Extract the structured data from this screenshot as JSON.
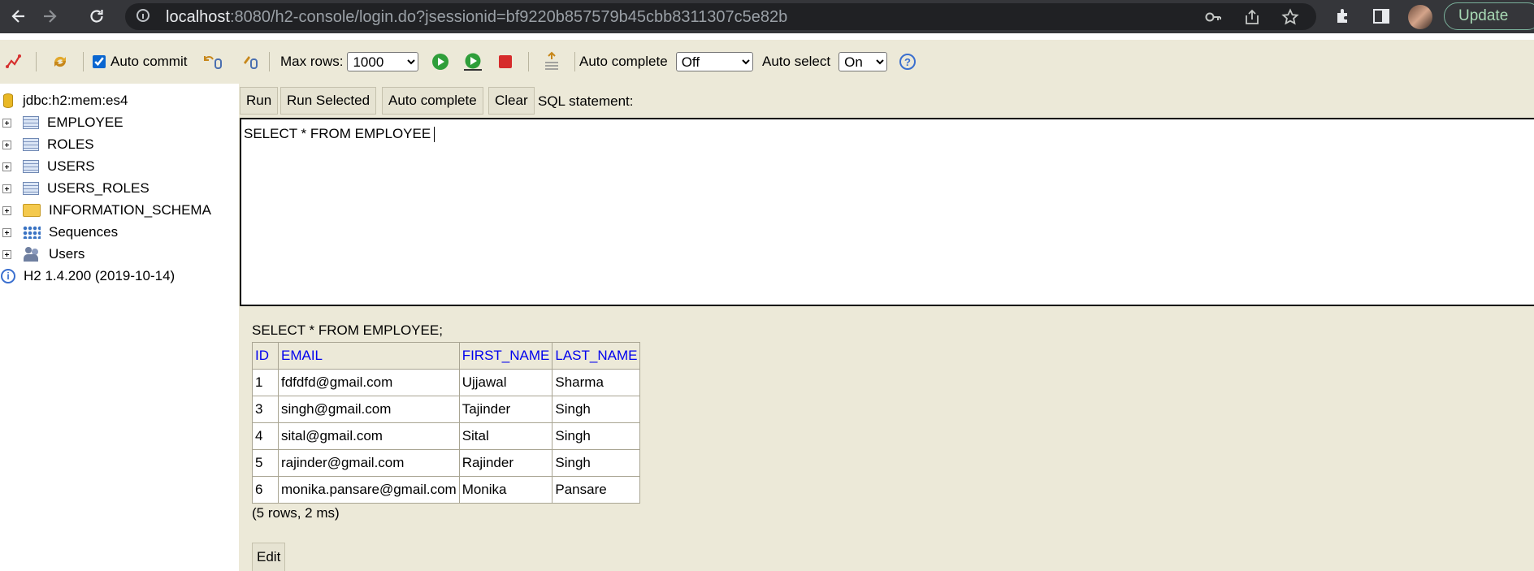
{
  "browser": {
    "url_host": "localhost",
    "url_rest": ":8080/h2-console/login.do?jsessionid=bf9220b857579b45cbb8311307c5e82b",
    "update_label": "Update"
  },
  "toolbar": {
    "auto_commit_label": "Auto commit",
    "auto_commit_checked": true,
    "max_rows_label": "Max rows:",
    "max_rows_value": "1000",
    "auto_complete_label": "Auto complete",
    "auto_complete_value": "Off",
    "auto_select_label": "Auto select",
    "auto_select_value": "On",
    "help_label": "?"
  },
  "tree": {
    "connection": "jdbc:h2:mem:es4",
    "items": [
      {
        "label": "EMPLOYEE",
        "icon": "table-icon"
      },
      {
        "label": "ROLES",
        "icon": "table-icon"
      },
      {
        "label": "USERS",
        "icon": "table-icon"
      },
      {
        "label": "USERS_ROLES",
        "icon": "table-icon"
      },
      {
        "label": "INFORMATION_SCHEMA",
        "icon": "folder-icon"
      },
      {
        "label": "Sequences",
        "icon": "sequences-icon"
      },
      {
        "label": "Users",
        "icon": "users-icon"
      }
    ],
    "version": "H2 1.4.200 (2019-10-14)",
    "info_glyph": "i"
  },
  "buttons": {
    "run": "Run",
    "run_selected": "Run Selected",
    "auto_complete": "Auto complete",
    "clear": "Clear",
    "sql_statement_label": "SQL statement:"
  },
  "editor": {
    "text": "SELECT * FROM EMPLOYEE"
  },
  "result": {
    "query": "SELECT * FROM EMPLOYEE;",
    "columns": [
      "ID",
      "EMAIL",
      "FIRST_NAME",
      "LAST_NAME"
    ],
    "rows": [
      [
        "1",
        "fdfdfd@gmail.com",
        "Ujjawal",
        "Sharma"
      ],
      [
        "3",
        "singh@gmail.com",
        "Tajinder",
        "Singh"
      ],
      [
        "4",
        "sital@gmail.com",
        "Sital",
        "Singh"
      ],
      [
        "5",
        "rajinder@gmail.com",
        "Rajinder",
        "Singh"
      ],
      [
        "6",
        "monika.pansare@gmail.com",
        "Monika",
        "Pansare"
      ]
    ],
    "info": "(5 rows, 2 ms)",
    "edit_label": "Edit"
  }
}
